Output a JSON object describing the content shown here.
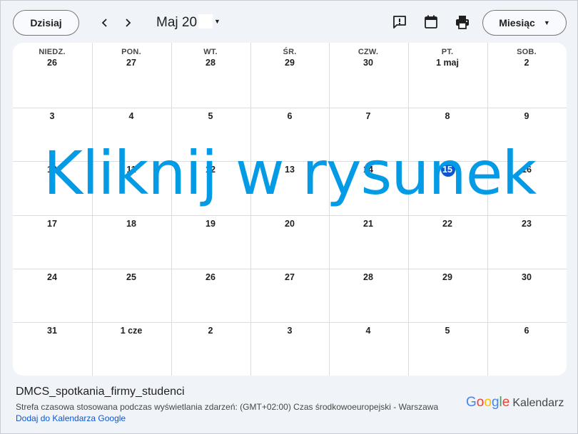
{
  "toolbar": {
    "today_label": "Dzisiaj",
    "prev_icon": "chevron-left-icon",
    "next_icon": "chevron-right-icon",
    "month_title": "Maj 20",
    "feedback_icon": "feedback-icon",
    "calendar_icon": "calendar-icon",
    "print_icon": "print-icon",
    "view_label": "Miesiąc"
  },
  "weekdays": [
    "NIEDZ.",
    "PON.",
    "WT.",
    "ŚR.",
    "CZW.",
    "PT.",
    "SOB."
  ],
  "weeks": [
    [
      "26",
      "27",
      "28",
      "29",
      "30",
      "1 maj",
      "2"
    ],
    [
      "3",
      "4",
      "5",
      "6",
      "7",
      "8",
      "9"
    ],
    [
      "10",
      "11",
      "12",
      "13",
      "14",
      "15",
      "16"
    ],
    [
      "17",
      "18",
      "19",
      "20",
      "21",
      "22",
      "23"
    ],
    [
      "24",
      "25",
      "26",
      "27",
      "28",
      "29",
      "30"
    ],
    [
      "31",
      "1 cze",
      "2",
      "3",
      "4",
      "5",
      "6"
    ]
  ],
  "overlay_text": "Kliknij w rysunek",
  "footer": {
    "calendar_name": "DMCS_spotkania_firmy_studenci",
    "timezone_text": "Strefa czasowa stosowana podczas wyświetlania zdarzeń: (GMT+02:00) Czas środkowoeuropejski - Warszawa",
    "add_link": "Dodaj do Kalendarza Google",
    "brand_google": "Google",
    "brand_product": "Kalendarz"
  },
  "colors": {
    "accent": "#0b57d0",
    "overlay": "#039be5",
    "background": "#f0f4f9"
  }
}
